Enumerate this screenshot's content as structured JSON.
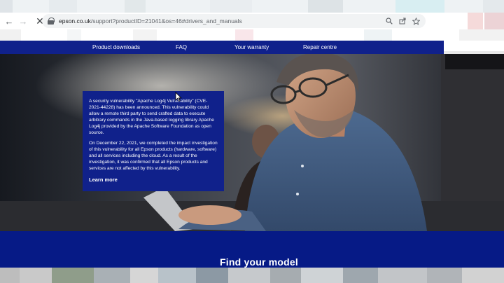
{
  "browser": {
    "url_host": "epson.co.uk",
    "url_path": "/support?productID=21041&os=46#drivers_and_manuals",
    "icons": {
      "back": "arrow-left-icon",
      "forward": "arrow-right-icon",
      "stop": "close-icon",
      "zoom": "magnifier-zoom-icon",
      "share": "share-icon",
      "bookmark": "star-icon"
    }
  },
  "site_nav": {
    "items": [
      {
        "label": "Product downloads"
      },
      {
        "label": "FAQ"
      },
      {
        "label": "Your warranty"
      },
      {
        "label": "Repair centre"
      }
    ],
    "color": "#10218b"
  },
  "notice": {
    "paragraph_1": "A security vulnerability \"Apache Log4j Vulnerability\" (CVE-2021-44228) has been announced. This vulnerability could allow a remote third party to send crafted data to execute arbitrary commands in the Java-based logging library Apache Log4j provided by the Apache Software Foundation as open source.",
    "paragraph_2": "On December 22, 2021, we completed the impact investigation of this vulnerability for all Epson products (hardware, software) and all services including the cloud. As a result of the investigation, it was confirmed that all Epson products and services are not affected by this vulnerability.",
    "link_label": "Learn more"
  },
  "find_model": {
    "heading": "Find your model",
    "band_color": "#061a86"
  }
}
